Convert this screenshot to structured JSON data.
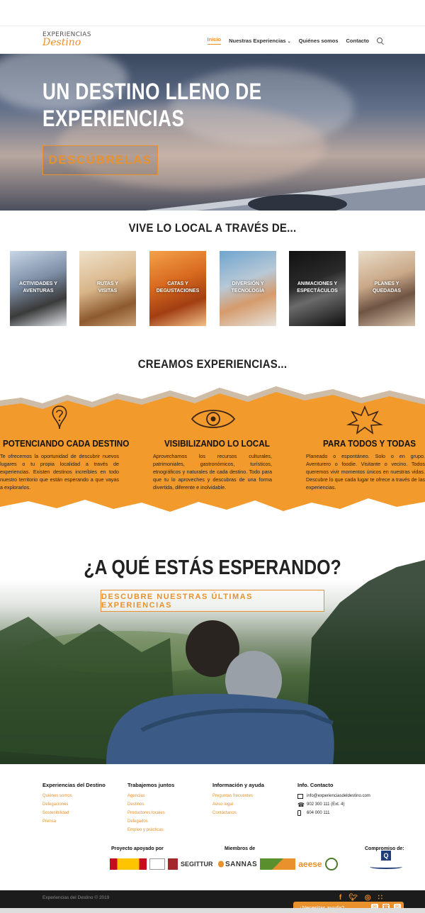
{
  "header": {
    "logo_line1": "EXPERIENCIAS",
    "logo_line2": "Destino",
    "nav": [
      {
        "label": "Inicio",
        "active": true
      },
      {
        "label": "Nuestras Experiencias",
        "dropdown": true
      },
      {
        "label": "Quiénes somos"
      },
      {
        "label": "Contacto"
      }
    ],
    "search_icon": "search-icon"
  },
  "hero": {
    "title_line1": "UN DESTINO LLENO DE",
    "title_line2": "EXPERIENCIAS",
    "button": "DESCÚBRELAS"
  },
  "section_local": {
    "heading": "VIVE LO LOCAL A TRAVÉS DE...",
    "tiles": [
      {
        "line1": "ACTIVIDADES Y",
        "line2": "AVENTURAS"
      },
      {
        "line1": "RUTAS Y",
        "line2": "VISITAS"
      },
      {
        "line1": "CATAS Y",
        "line2": "DEGUSTACIONES"
      },
      {
        "line1": "DIVERSIÓN Y",
        "line2": "TECNOLOGÍA"
      },
      {
        "line1": "ANIMACIONES Y",
        "line2": "ESPECTÁCULOS"
      },
      {
        "line1": "PLANES Y",
        "line2": "QUEDADAS"
      }
    ]
  },
  "section_create": {
    "heading": "CREAMOS EXPERIENCIAS...",
    "columns": [
      {
        "title": "POTENCIANDO CADA DESTINO",
        "text": "Te ofrecemos la oportunidad de descubrir nuevos lugares o tu propia localidad a través de experiencias. Existen destinos increíbles en todo nuestro territorio que están esperando a que vayas a explorarlos."
      },
      {
        "title": "VISIBILIZANDO LO LOCAL",
        "text": "Aprovechamos los recursos culturales, patrimoniales, gastronómicos, turísticos, etnográficos y naturales de cada destino. Todo para que tu lo aproveches y descubras de una forma divertida, diferente e inolvidable."
      },
      {
        "title": "PARA TODOS Y TODAS",
        "text": "Planeado o espontáneo. Solo o en grupo. Aventurero o foodie. Visitante o vecino. Todos queremos vivir momentos únicos en nuestras vidas. Descubre lo que cada lugar te ofrece a través de las experiencias."
      }
    ]
  },
  "cta": {
    "title": "¿A QUÉ ESTÁS ESPERANDO?",
    "button": "DESCUBRE NUESTRAS ÚLTIMAS EXPERIENCIAS"
  },
  "footer": {
    "col1": {
      "title": "Experiencias del Destino",
      "links": [
        "Quiénes somos",
        "Delegaciones",
        "Sostenibilidad",
        "Prensa"
      ]
    },
    "col2": {
      "title": "Trabajemos juntos",
      "links": [
        "Agencias",
        "Destinos",
        "Productores locales",
        "Delegados",
        "Empleo y prácticas"
      ]
    },
    "col3": {
      "title": "Información y ayuda",
      "links": [
        "Preguntas frecuentes",
        "Aviso legal",
        "Contáctanos"
      ]
    },
    "col4": {
      "title": "Info. Contacto",
      "email": "info@experienciasdeldestino.com",
      "phone": "902 300 111 (Ext. 4)",
      "mobile": "604 000 111"
    },
    "sponsor_label": "Proyecto apoyado por",
    "members_label": "Miembros de",
    "commitment_label": "Compromiso de:",
    "logo_texts": {
      "segittur": "SEGITTUR",
      "sannas": "SANNAS",
      "aeese": "aeese"
    },
    "copyright": "Experiencias del Destino © 2019",
    "help": "¿Necesitas ayuda?"
  },
  "colors": {
    "accent": "#e8912d",
    "dark": "#1c1c1c"
  }
}
